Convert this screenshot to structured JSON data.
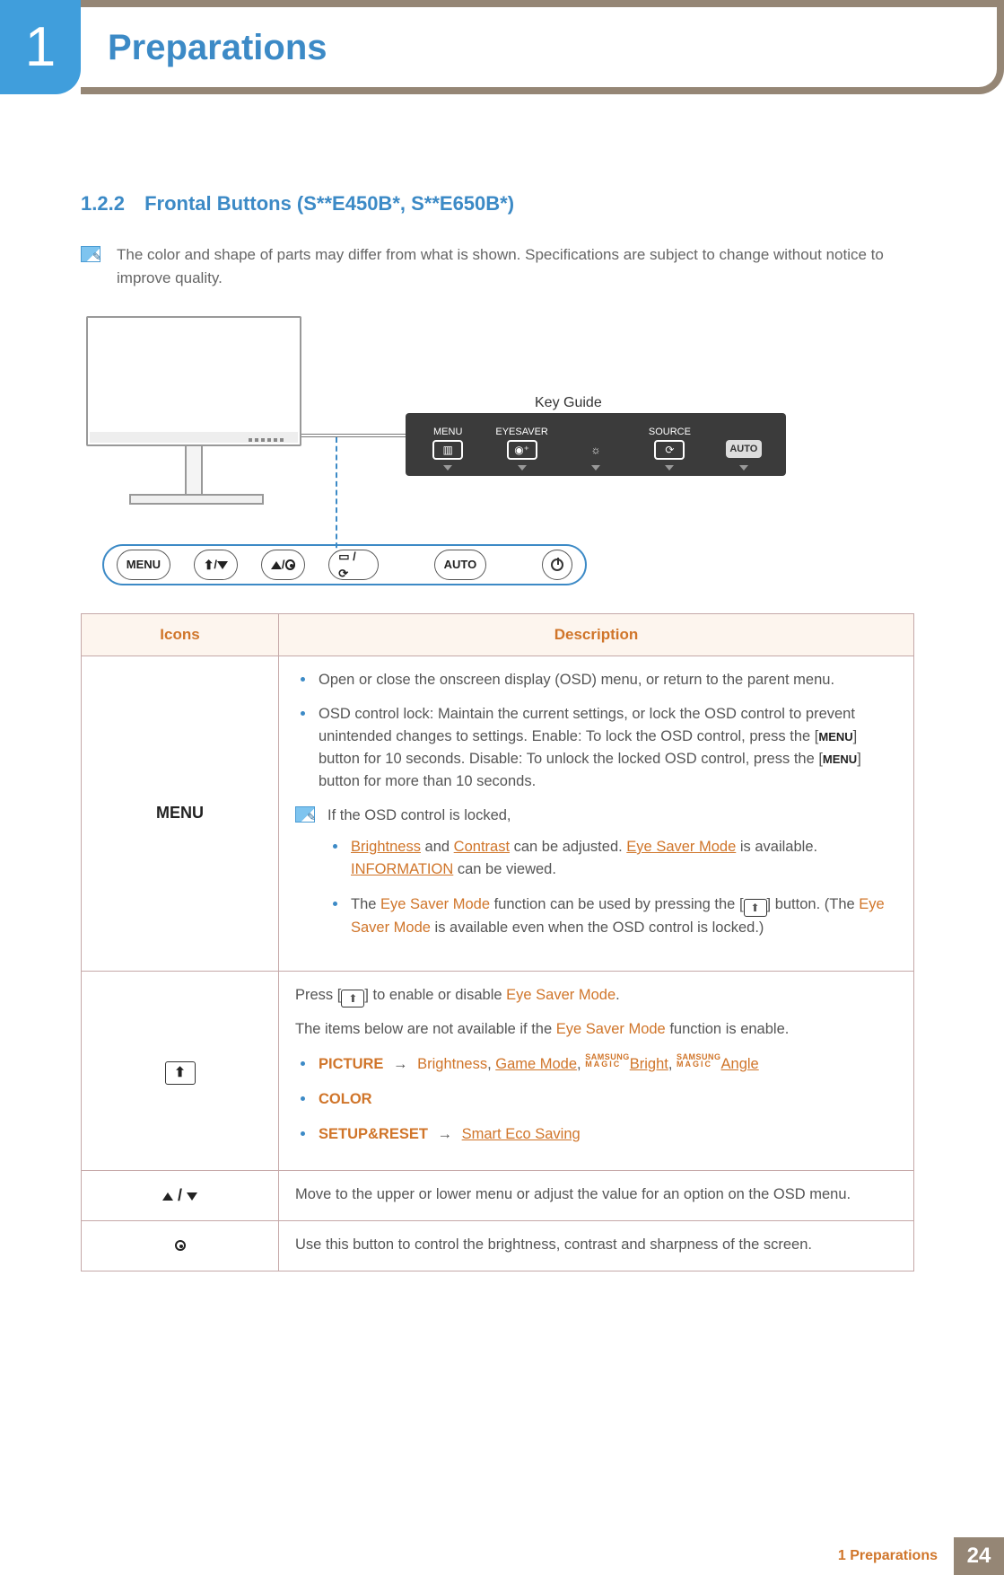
{
  "header": {
    "chapter_number": "1",
    "chapter_title": "Preparations"
  },
  "section": {
    "number": "1.2.2",
    "title": "Frontal Buttons (S**E450B*, S**E650B*)"
  },
  "intro_note": "The color and shape of parts may differ from what is shown. Specifications are subject to change without notice to improve quality.",
  "diagram": {
    "key_guide_label": "Key Guide",
    "osd": {
      "menu_label": "MENU",
      "eye_saver_label_1": "EYE",
      "eye_saver_label_2": "SAVER",
      "source_label": "SOURCE",
      "auto_label": "AUTO"
    },
    "rail": {
      "menu": "MENU",
      "auto": "AUTO"
    }
  },
  "table": {
    "headers": {
      "icons": "Icons",
      "description": "Description"
    },
    "menu_row": {
      "icon_label": "MENU",
      "b1": "Open or close the onscreen display (OSD) menu, or return to the parent menu.",
      "b2_a": "OSD control lock: Maintain the current settings, or lock the OSD control to prevent unintended changes to settings. Enable: To lock the OSD control, press the [",
      "b2_b": "] button for 10 seconds. Disable: To unlock the locked OSD control, press the [",
      "b2_c": "] button for more than 10 seconds.",
      "menu_small": "MENU",
      "sub_heading": "If the OSD control is locked,",
      "sub1_a": "Brightness",
      "sub1_b": " and ",
      "sub1_c": "Contrast",
      "sub1_d": " can be adjusted. ",
      "sub1_e": "Eye Saver Mode",
      "sub1_f": " is available. ",
      "sub1_g": "INFORMATION",
      "sub1_h": " can be viewed.",
      "sub2_a": "The ",
      "sub2_b": "Eye Saver Mode",
      "sub2_c": " function can be used by pressing the [",
      "sub2_d": "] button. (The ",
      "sub2_e": "Eye Saver Mode",
      "sub2_f": " is available even when the OSD control is locked.)"
    },
    "eye_row": {
      "p1_a": "Press [",
      "p1_b": "] to enable or disable ",
      "p1_c": "Eye Saver Mode",
      "p1_d": ".",
      "p2_a": "The items below are not available if the ",
      "p2_b": "Eye Saver Mode",
      "p2_c": " function is enable.",
      "li1_a": "PICTURE",
      "li1_arrow": "→",
      "li1_b": "Brightness",
      "li1_c": "Game Mode",
      "li1_d": "Bright",
      "li1_e": "Angle",
      "magic1": "SAMSUNG",
      "magic2": "MAGIC",
      "li2": "COLOR",
      "li3_a": "SETUP&RESET",
      "li3_arrow": "→",
      "li3_b": "Smart Eco Saving"
    },
    "updown_row": {
      "text": "Move to the upper or lower menu or adjust the value for an option on the OSD menu."
    },
    "dot_row": {
      "text": "Use this button to control the brightness, contrast and sharpness of the screen."
    }
  },
  "footer": {
    "crumb": "1 Preparations",
    "page": "24"
  }
}
